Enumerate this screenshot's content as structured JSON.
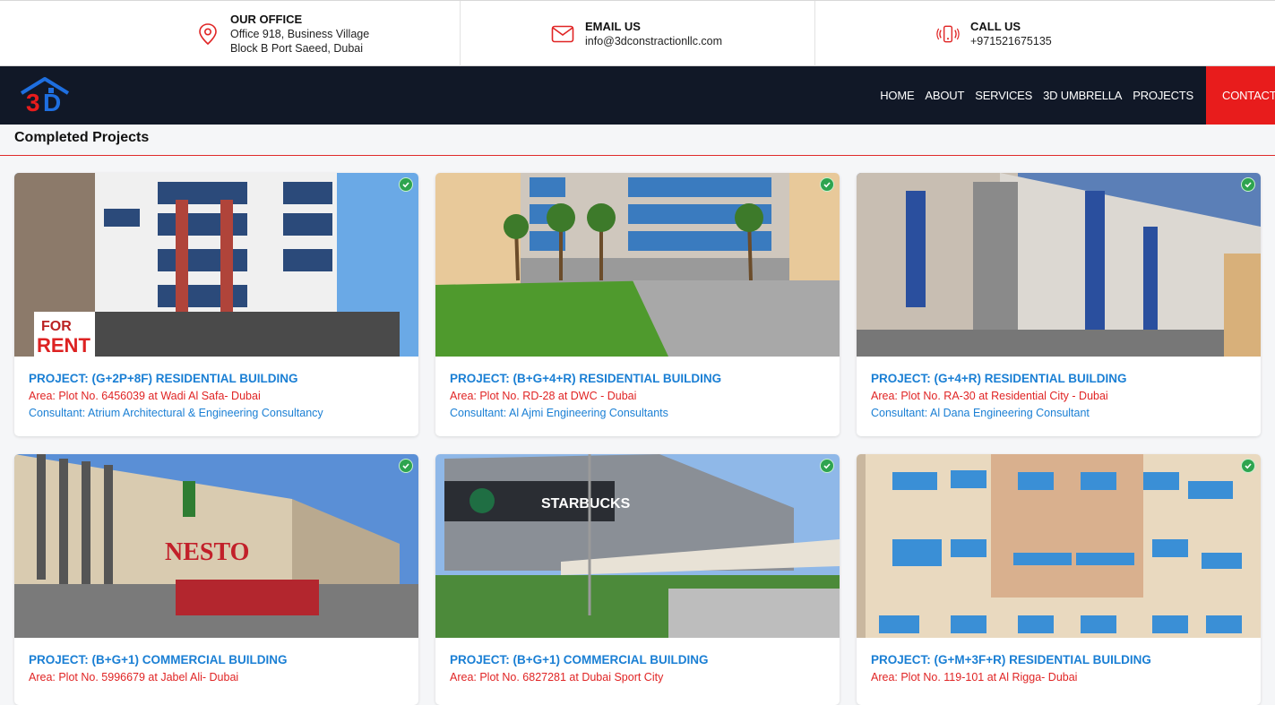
{
  "topbar": {
    "office": {
      "icon": "location-pin-icon",
      "title": "OUR OFFICE",
      "line1": "Office 918, Business Village",
      "line2": "Block B Port Saeed, Dubai"
    },
    "email": {
      "icon": "envelope-icon",
      "title": "EMAIL US",
      "value": "info@3dconstractionllc.com"
    },
    "call": {
      "icon": "phone-ringing-icon",
      "title": "CALL US",
      "value": "+971521675135"
    }
  },
  "nav": {
    "logo_text": "3D",
    "items": [
      "HOME",
      "ABOUT",
      "SERVICES",
      "3D UMBRELLA",
      "PROJECTS"
    ],
    "contact": "CONTACT"
  },
  "section": {
    "title": "Completed Projects"
  },
  "colors": {
    "accent_red": "#e81c1c",
    "nav_bg": "#111827",
    "link_blue": "#1a7fd4",
    "area_red": "#e02424",
    "check_green": "#2ea44f"
  },
  "projects": [
    {
      "title": "PROJECT: (G+2P+8F) RESIDENTIAL BUILDING",
      "area": "Area: Plot No. 6456039 at Wadi Al Safa- Dubai",
      "consultant": "Consultant: Atrium Architectural & Engineering Consultancy",
      "banner": "FOR",
      "banner2": "RENT"
    },
    {
      "title": "PROJECT: (B+G+4+R) RESIDENTIAL BUILDING",
      "area": "Area: Plot No. RD-28 at DWC - Dubai",
      "consultant": "Consultant: Al Ajmi Engineering Consultants"
    },
    {
      "title": "PROJECT: (G+4+R) RESIDENTIAL BUILDING",
      "area": "Area: Plot No. RA-30 at Residential City - Dubai",
      "consultant": "Consultant: Al Dana Engineering Consultant"
    },
    {
      "title": "PROJECT: (B+G+1) COMMERCIAL BUILDING",
      "area": "Area: Plot No. 5996679 at Jabel Ali- Dubai",
      "consultant": "",
      "sign": "NESTO"
    },
    {
      "title": "PROJECT: (B+G+1) COMMERCIAL BUILDING",
      "area": "Area: Plot No. 6827281 at Dubai Sport City",
      "consultant": "",
      "sign": "STARBUCKS"
    },
    {
      "title": "PROJECT: (G+M+3F+R) RESIDENTIAL BUILDING",
      "area": "Area: Plot No. 119-101 at Al Rigga- Dubai",
      "consultant": ""
    }
  ]
}
